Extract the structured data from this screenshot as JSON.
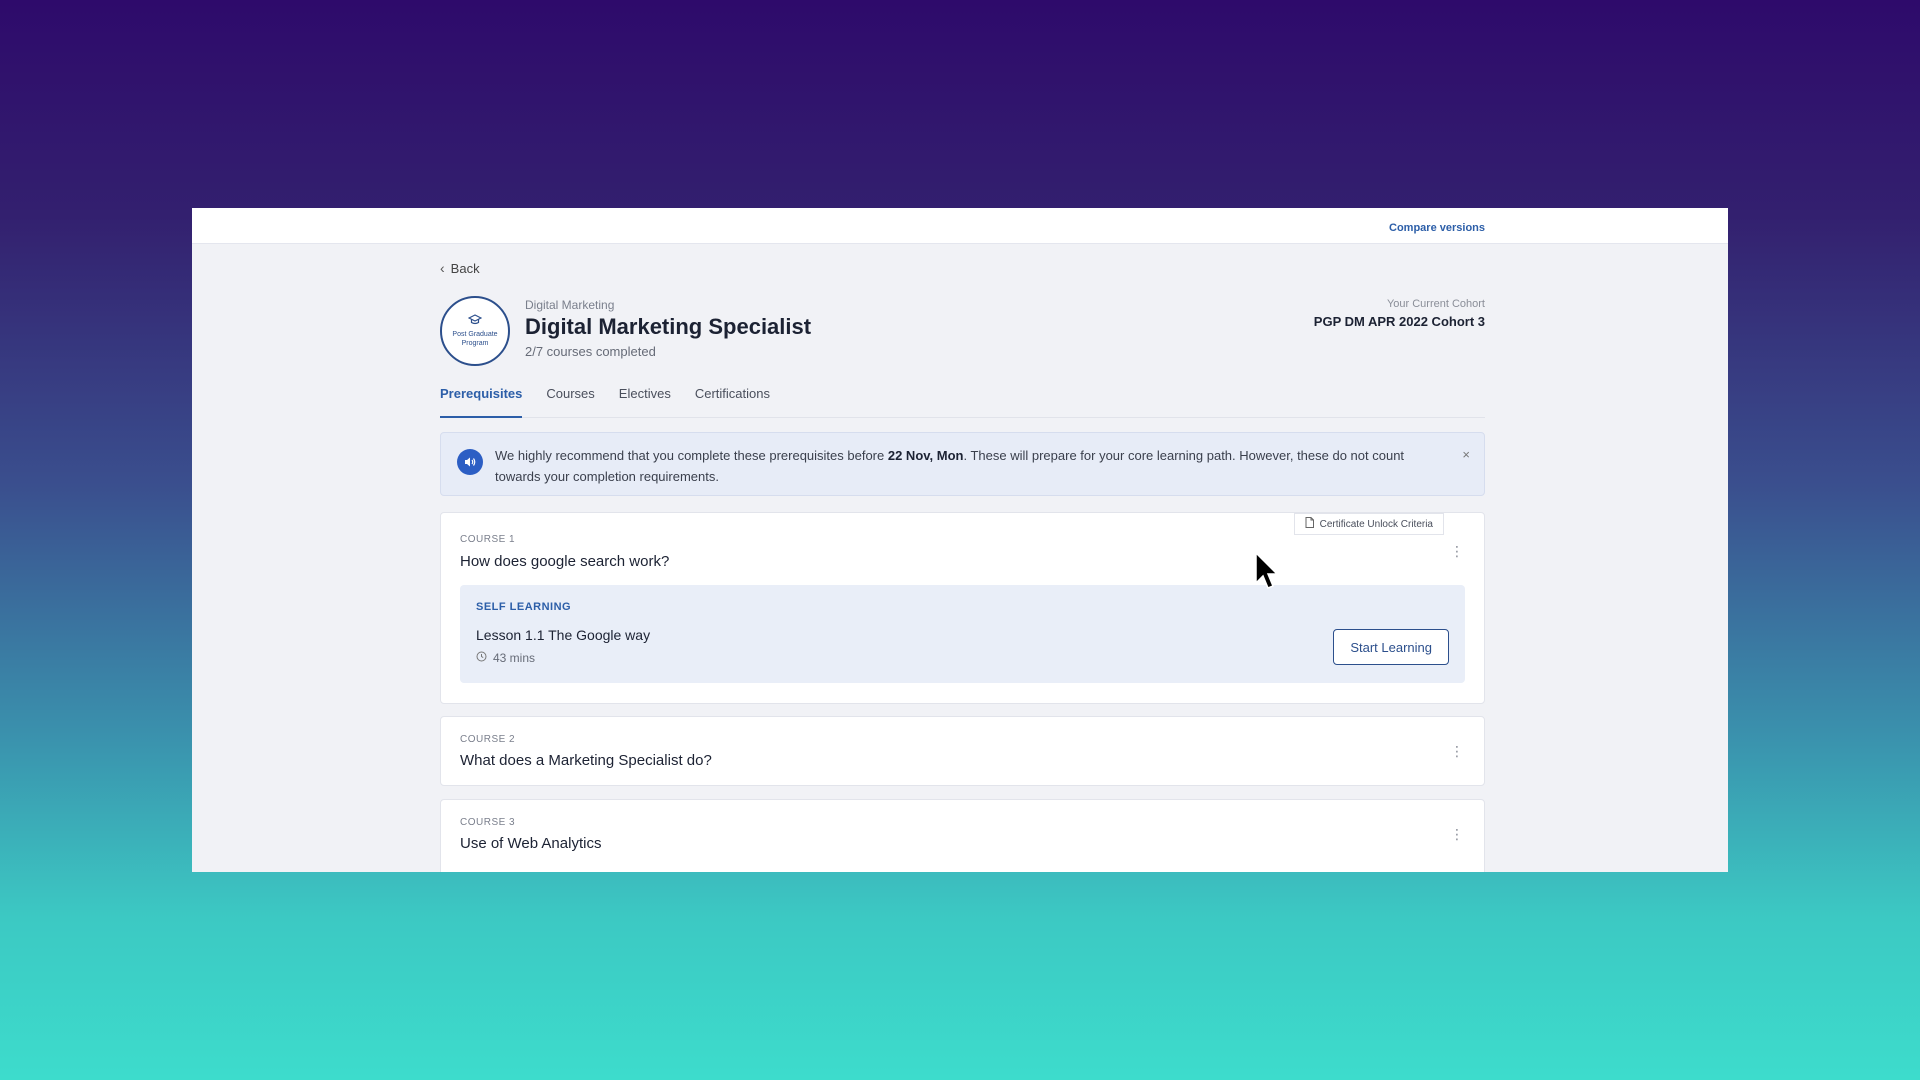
{
  "topbar": {
    "compare_label": "Compare versions"
  },
  "nav": {
    "back_label": "Back"
  },
  "program": {
    "badge_text": "Post Graduate Program",
    "category": "Digital Marketing",
    "title": "Digital Marketing Specialist",
    "progress": "2/7 courses completed"
  },
  "cohort": {
    "label": "Your Current Cohort",
    "value": "PGP DM APR 2022 Cohort 3"
  },
  "tabs": [
    {
      "label": "Prerequisites",
      "active": true
    },
    {
      "label": "Courses"
    },
    {
      "label": "Electives"
    },
    {
      "label": "Certifications"
    }
  ],
  "notice": {
    "text_before": "We highly recommend that you complete these prerequisites before ",
    "date": "22 Nov, Mon",
    "text_after": ". These will prepare for your core learning path. However, these do not count towards your completion requirements.",
    "close": "×"
  },
  "courses": [
    {
      "label": "COURSE 1",
      "title": "How does google search work?",
      "cert_label": "Certificate Unlock Criteria",
      "lesson": {
        "tag": "SELF LEARNING",
        "title": "Lesson 1.1 The Google way",
        "duration": "43 mins",
        "button": "Start Learning"
      }
    },
    {
      "label": "COURSE 2",
      "title": "What does a Marketing Specialist do?"
    },
    {
      "label": "COURSE 3",
      "title": "Use of Web Analytics"
    }
  ],
  "icons": {
    "kebab": "⋮",
    "back": "‹"
  },
  "colors": {
    "accent": "#2c5ea8",
    "title": "#1c2233"
  }
}
